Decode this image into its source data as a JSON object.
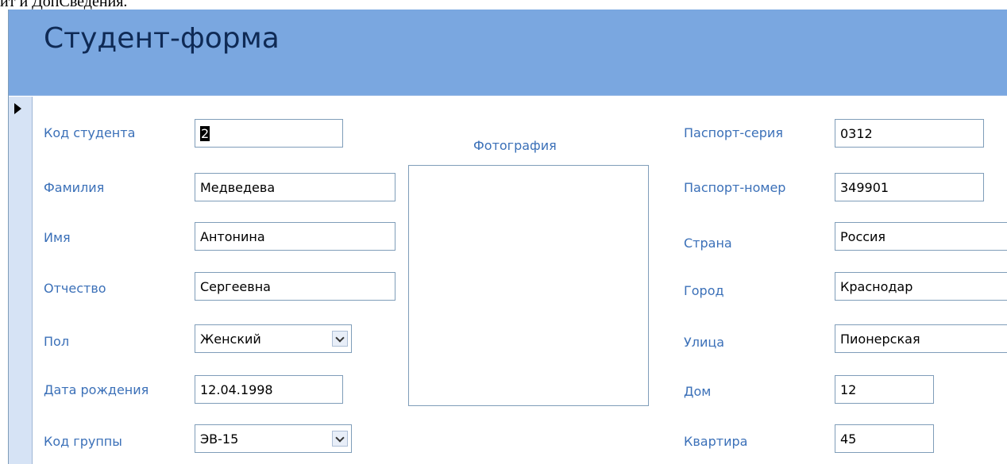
{
  "top_text": "ит и ДопСведения.",
  "form": {
    "title": "Студент-форма",
    "left_fields": [
      {
        "label": "Код студента",
        "value": "2"
      },
      {
        "label": "Фамилия",
        "value": "Медведева"
      },
      {
        "label": "Имя",
        "value": "Антонина"
      },
      {
        "label": "Отчество",
        "value": "Сергеевна"
      },
      {
        "label": "Пол",
        "value": "Женский"
      },
      {
        "label": "Дата рождения",
        "value": "12.04.1998"
      },
      {
        "label": "Код группы",
        "value": "ЭВ-15"
      }
    ],
    "photo_label": "Фотография",
    "right_fields": [
      {
        "label": "Паспорт-серия",
        "value": "0312"
      },
      {
        "label": "Паспорт-номер",
        "value": "349901"
      },
      {
        "label": "Страна",
        "value": "Россия"
      },
      {
        "label": "Город",
        "value": "Краснодар"
      },
      {
        "label": "Улица",
        "value": "Пионерская"
      },
      {
        "label": "Дом",
        "value": "12"
      },
      {
        "label": "Квартира",
        "value": "45"
      }
    ]
  },
  "colors": {
    "header": "#7aa7e0",
    "label": "#3b70b8",
    "title": "#0f2a55",
    "border": "#7f9db9"
  },
  "icons": {
    "record_selector": "record-selector-arrow-icon",
    "dropdown": "chevron-down-icon"
  }
}
